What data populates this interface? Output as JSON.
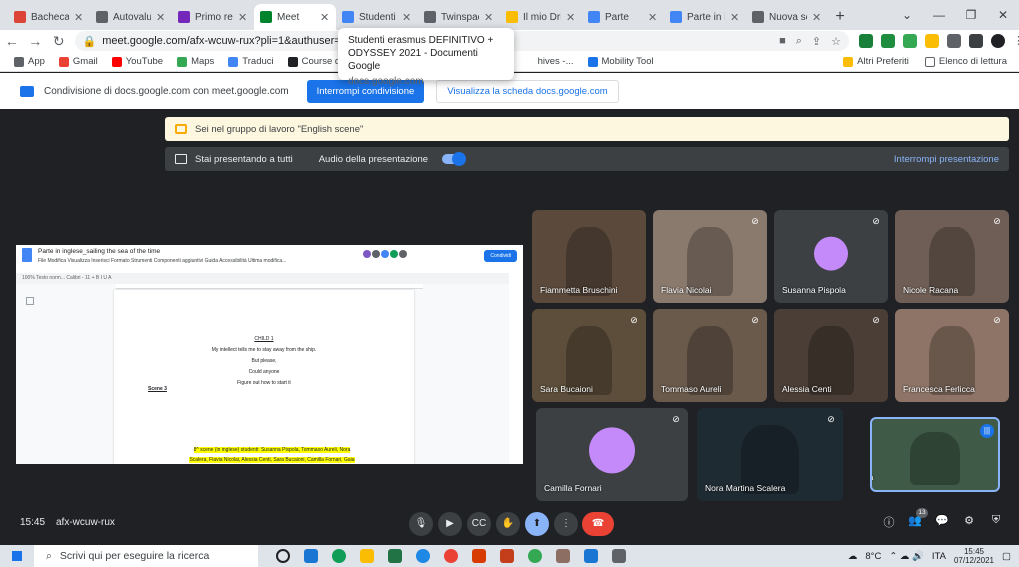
{
  "tabs": [
    {
      "label": "Bacheca",
      "color": "#db4437"
    },
    {
      "label": "Autovalutazione",
      "color": "#5f6368"
    },
    {
      "label": "Primo report",
      "color": "#7627bb"
    },
    {
      "label": "Meet",
      "color": "#00832d",
      "active": true
    },
    {
      "label": "Studenti erasmus",
      "color": "#4285f4"
    },
    {
      "label": "Twinspace",
      "color": "#5f6368"
    },
    {
      "label": "Il mio Drive",
      "color": "#fbbc04"
    },
    {
      "label": "Parte",
      "color": "#4285f4"
    },
    {
      "label": "Parte in inglese",
      "color": "#4285f4"
    },
    {
      "label": "Nuova scheda",
      "color": "#5f6368"
    }
  ],
  "url": "meet.google.com/afx-wcuw-rux?pli=1&authuser=0",
  "tooltip": {
    "title": "Studenti erasmus DEFINITIVO + ODYSSEY 2021 - Documenti Google",
    "domain": "docs.google.com"
  },
  "bookmarks": [
    {
      "label": "App",
      "color": "#5f6368"
    },
    {
      "label": "Gmail",
      "color": "#ea4335"
    },
    {
      "label": "YouTube",
      "color": "#ff0000"
    },
    {
      "label": "Maps",
      "color": "#34a853"
    },
    {
      "label": "Traduci",
      "color": "#4285f4"
    },
    {
      "label": "Course detail",
      "color": "#202124"
    }
  ],
  "bookmarks_mid": {
    "label": "hives -...",
    "mobility": "Mobility Tool"
  },
  "bookmarks_right": {
    "altri": "Altri Preferiti",
    "lettura": "Elenco di lettura"
  },
  "sharebar": {
    "text": "Condivisione di docs.google.com con meet.google.com",
    "stop": "Interrompi condivisione",
    "view": "Visualizza la scheda docs.google.com"
  },
  "banner": "Sei nel gruppo di lavoro \"English scene\"",
  "presentbar": {
    "status": "Stai presentando a tutti",
    "audio": "Audio della presentazione",
    "stop": "Interrompi presentazione"
  },
  "doc": {
    "title": "Parte in inglese_sailing the sea of the time",
    "menu": "File   Modifica   Visualizza   Inserisci   Formato   Strumenti   Componenti aggiuntivi   Guida   Accessibilità   Ultima modifica...",
    "share": "Condividi",
    "format": "100%    Testo norm...    Calibri    -  11  +    B  I  U  A",
    "lines": [
      "CHILD 1",
      "My intellect tells me to stay away from the ship.",
      "But please,",
      "Could anyone",
      "Figure out how to start it"
    ],
    "scene": "Scene 3",
    "highlight1": "8^ scene (in inglese) studenti: Susanna Pispola, Tommaso Aureli, Nora",
    "highlight2": "Scalera, Flavia Nicolai, Alessia Centi, Sara Bucaioni, Camilla Fornari, Gaia"
  },
  "participants": [
    {
      "name": "Fiammetta Bruschini",
      "bg": "#5b4a3c",
      "muted": false
    },
    {
      "name": "Flavia Nicolai",
      "bg": "#8a7a6e",
      "muted": true
    },
    {
      "name": "Susanna Pispola",
      "bg": "#3c4043",
      "muted": true,
      "avatar": true
    },
    {
      "name": "Nicole Racana",
      "bg": "#6e5e55",
      "muted": true
    },
    {
      "name": "Sara Bucaioni",
      "bg": "#5c4e3a",
      "muted": true
    },
    {
      "name": "Tommaso Aureli",
      "bg": "#6a5a4c",
      "muted": true
    },
    {
      "name": "Alessia Centi",
      "bg": "#4a3e36",
      "muted": true
    },
    {
      "name": "Francesca Ferlicca",
      "bg": "#8d7466",
      "muted": true
    },
    {
      "name": "Camilla Fornari",
      "bg": "#3c4043",
      "muted": true,
      "avatar": true
    },
    {
      "name": "Nora Martina Scalera",
      "bg": "#1f2b33",
      "muted": true
    },
    {
      "name": "Ga",
      "bg": "#3f5a46",
      "muted": false,
      "self": true
    }
  ],
  "meeting": {
    "time": "15:45",
    "code": "afx-wcuw-rux",
    "participant_count": "13"
  },
  "taskbar": {
    "search": "Scrivi qui per eseguire la ricerca",
    "temp": "8°C",
    "lang": "ITA",
    "time": "15:45",
    "date": "07/12/2021"
  },
  "colors": {
    "accent": "#1a73e8",
    "hangup": "#ea4335",
    "meet_bg": "#202124"
  }
}
